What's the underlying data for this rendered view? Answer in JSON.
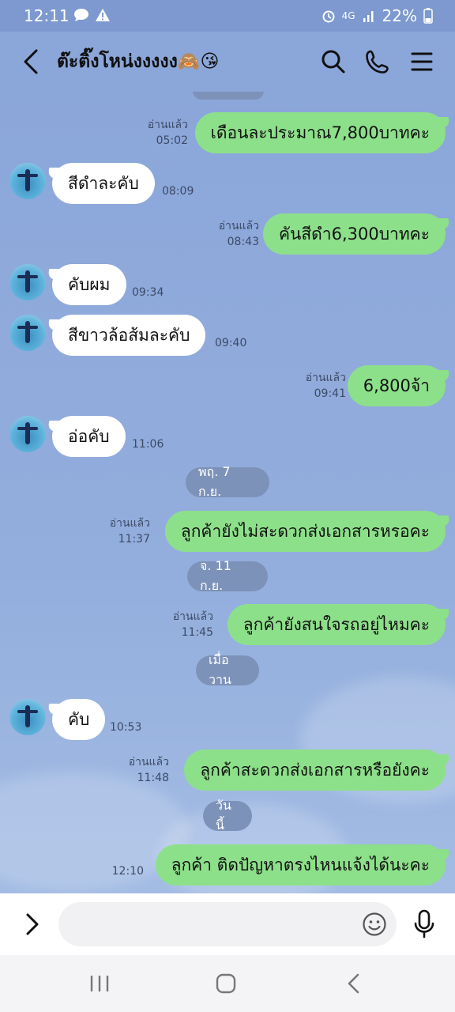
{
  "status_bar": {
    "time": "12:11",
    "network": "4G",
    "battery": "22%",
    "icons": [
      "chat-bubble-icon",
      "warning-icon",
      "alarm-icon",
      "signal-icon",
      "battery-icon"
    ]
  },
  "header": {
    "title": "ต๊ะติ๊งโหน่งงงงง🙈😘",
    "icons": [
      "back-arrow-icon",
      "search-icon",
      "phone-icon",
      "menu-icon"
    ]
  },
  "read_label": "อ่านแล้ว",
  "dates": {
    "d1": "พฤ. 7 ก.ย.",
    "d2": "จ. 11 ก.ย.",
    "d3": "เมื่อวาน",
    "d4": "วันนี้"
  },
  "messages": [
    {
      "dir": "out",
      "text": "เดือนละประมาณ7,800บาทคะ",
      "time": "05:02",
      "read": "อ่านแล้ว"
    },
    {
      "dir": "in",
      "text": "สีดำละคับ",
      "time": "08:09"
    },
    {
      "dir": "out",
      "text": "คันสีดำ6,300บาทคะ",
      "time": "08:43",
      "read": "อ่านแล้ว"
    },
    {
      "dir": "in",
      "text": "คับผม",
      "time": "09:34"
    },
    {
      "dir": "in",
      "text": "สีขาวล้อส้มละคับ",
      "time": "09:40"
    },
    {
      "dir": "out",
      "text": "6,800จ้า",
      "time": "09:41",
      "read": "อ่านแล้ว"
    },
    {
      "dir": "in",
      "text": "อ่อคับ",
      "time": "11:06"
    },
    {
      "dir": "out",
      "text": "ลูกค้ายังไม่สะดวกส่งเอกสารหรอคะ",
      "time": "11:37",
      "read": "อ่านแล้ว"
    },
    {
      "dir": "out",
      "text": "ลูกค้ายังสนใจรถอยู่ไหมคะ",
      "time": "11:45",
      "read": "อ่านแล้ว"
    },
    {
      "dir": "in",
      "text": "คับ",
      "time": "10:53"
    },
    {
      "dir": "out",
      "text": "ลูกค้าสะดวกส่งเอกสารหรือยังคะ",
      "time": "11:48",
      "read": "อ่านแล้ว"
    },
    {
      "dir": "out",
      "text": "ลูกค้า ติดปัญหาตรงไหนแจ้งได้นะคะ",
      "time": "12:10"
    }
  ],
  "input": {
    "placeholder": "",
    "value": ""
  },
  "colors": {
    "outgoing": "#8de08a",
    "incoming": "#ffffff",
    "background": "#8ba6d9"
  }
}
